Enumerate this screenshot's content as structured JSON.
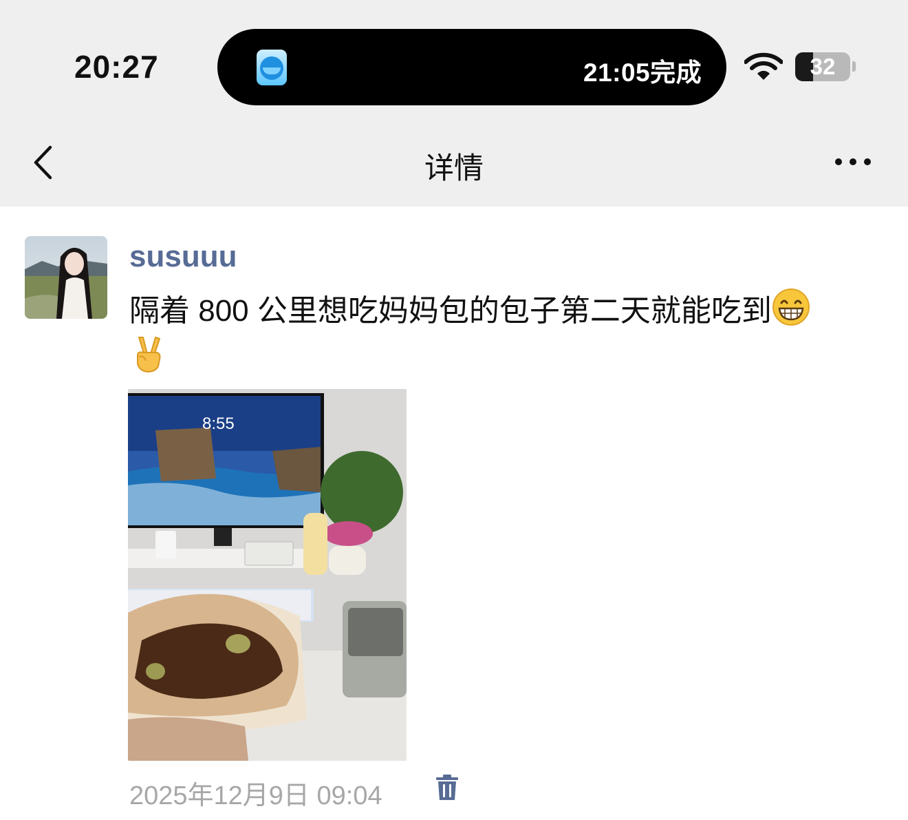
{
  "status_bar": {
    "time": "20:27",
    "activity_text": "21:05完成",
    "battery_level": "32",
    "battery_fraction": 0.32,
    "activity_app_icon": "blue-app-icon",
    "wifi_icon": "wifi-icon"
  },
  "nav": {
    "title": "详情",
    "back_icon": "chevron-left-icon",
    "more_icon": "ellipsis-icon"
  },
  "post": {
    "username": "susuuu",
    "text": "隔着 800 公里想吃妈妈包的包子第二天就能吃到",
    "emojis": [
      "grinning-face-emoji",
      "victory-hand-emoji"
    ],
    "photo": "photo of a bun held in hand in front of a desk with a monitor",
    "timestamp": "2025年12月9日 09:04",
    "delete_icon": "trash-icon"
  },
  "colors": {
    "header_bg": "#efefef",
    "username": "#576b95",
    "timestamp": "#a7a7a7"
  }
}
